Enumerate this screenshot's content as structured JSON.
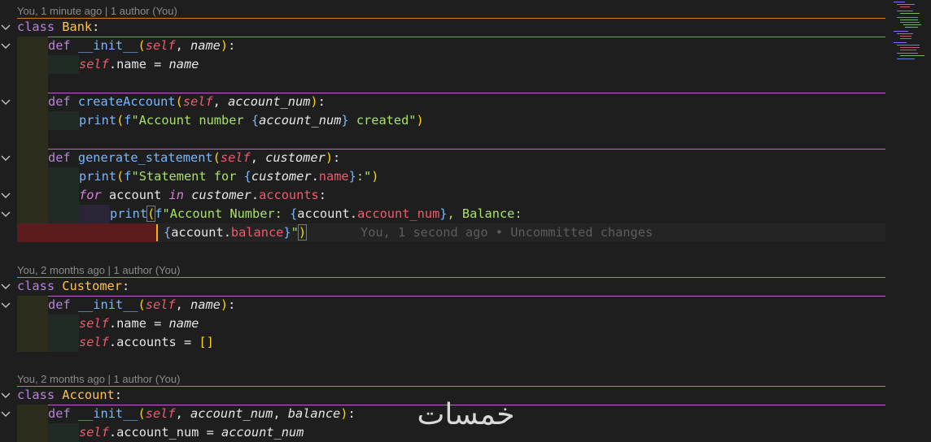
{
  "codelens": {
    "bank": "You, 1 minute ago | 1 author (You)",
    "customer": "You, 2 months ago | 1 author (You)",
    "account": "You, 2 months ago | 1 author (You)"
  },
  "blame": {
    "inline": "You, 1 second ago • Uncommitted changes"
  },
  "code": {
    "bank_class_kw": "class",
    "bank_class_name": "Bank",
    "customer_class_name": "Customer",
    "account_class_name": "Account",
    "def": "def",
    "init": "__init__",
    "self": "self",
    "name": "name",
    "createAccount": "createAccount",
    "account_num": "account_num",
    "print": "print",
    "str_account_number": "\"Account number ",
    "str_created": " created\"",
    "generate_statement": "generate_statement",
    "customer": "customer",
    "str_statement_for": "\"Statement for ",
    "str_colon_end": ":\"",
    "for": "for",
    "account": "account",
    "in": "in",
    "accounts": "accounts",
    "str_account_number2": "\"Account Number: ",
    "str_balance": ", Balance:",
    "balance": "balance",
    "empty_list": "[]",
    "balance_param": "balance"
  },
  "colors": {
    "background": "#1e1e1e",
    "class_rule": "#c9821e",
    "def_rule": "#b56ac0",
    "error_indent": "#5a1c1f",
    "cursor": "#ffb000"
  },
  "watermark": "خمسات"
}
